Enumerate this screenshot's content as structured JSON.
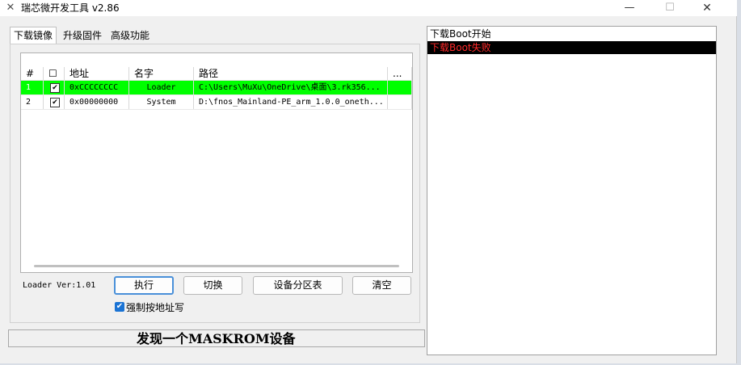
{
  "window": {
    "title": "瑞芯微开发工具 v2.86",
    "minimize": "—",
    "maximize": "☐",
    "close": "✕",
    "icon": "tools-icon"
  },
  "tabs": [
    {
      "label": "下载镜像",
      "active": true
    },
    {
      "label": "升级固件",
      "active": false
    },
    {
      "label": "高级功能",
      "active": false
    }
  ],
  "table": {
    "columns": [
      "#",
      "☐",
      "地址",
      "名字",
      "路径",
      "..."
    ],
    "rows": [
      {
        "num": "1",
        "checked": "✔",
        "address": "0xCCCCCCCC",
        "name": "Loader",
        "path": "C:\\Users\\MuXu\\OneDrive\\桌面\\3.rk356...",
        "highlight": true
      },
      {
        "num": "2",
        "checked": "✔",
        "address": "0x00000000",
        "name": "System",
        "path": "D:\\fnos_Mainland-PE_arm_1.0.0_oneth...",
        "highlight": false
      }
    ]
  },
  "loader_version": "Loader Ver:1.01",
  "buttons": {
    "execute": "执行",
    "switch": "切换",
    "partition_table": "设备分区表",
    "clear": "清空"
  },
  "force_write": {
    "label": "强制按地址写",
    "checked": "✔"
  },
  "status": "发现一个MASKROM设备",
  "log": [
    {
      "text": "下载Boot开始",
      "error": false
    },
    {
      "text": "下载Boot失败",
      "error": true
    }
  ],
  "colors": {
    "highlight_row": "#00ff00",
    "log_error_text": "#ff2a2a",
    "log_error_bg": "#000000",
    "accent": "#1a73d4"
  }
}
